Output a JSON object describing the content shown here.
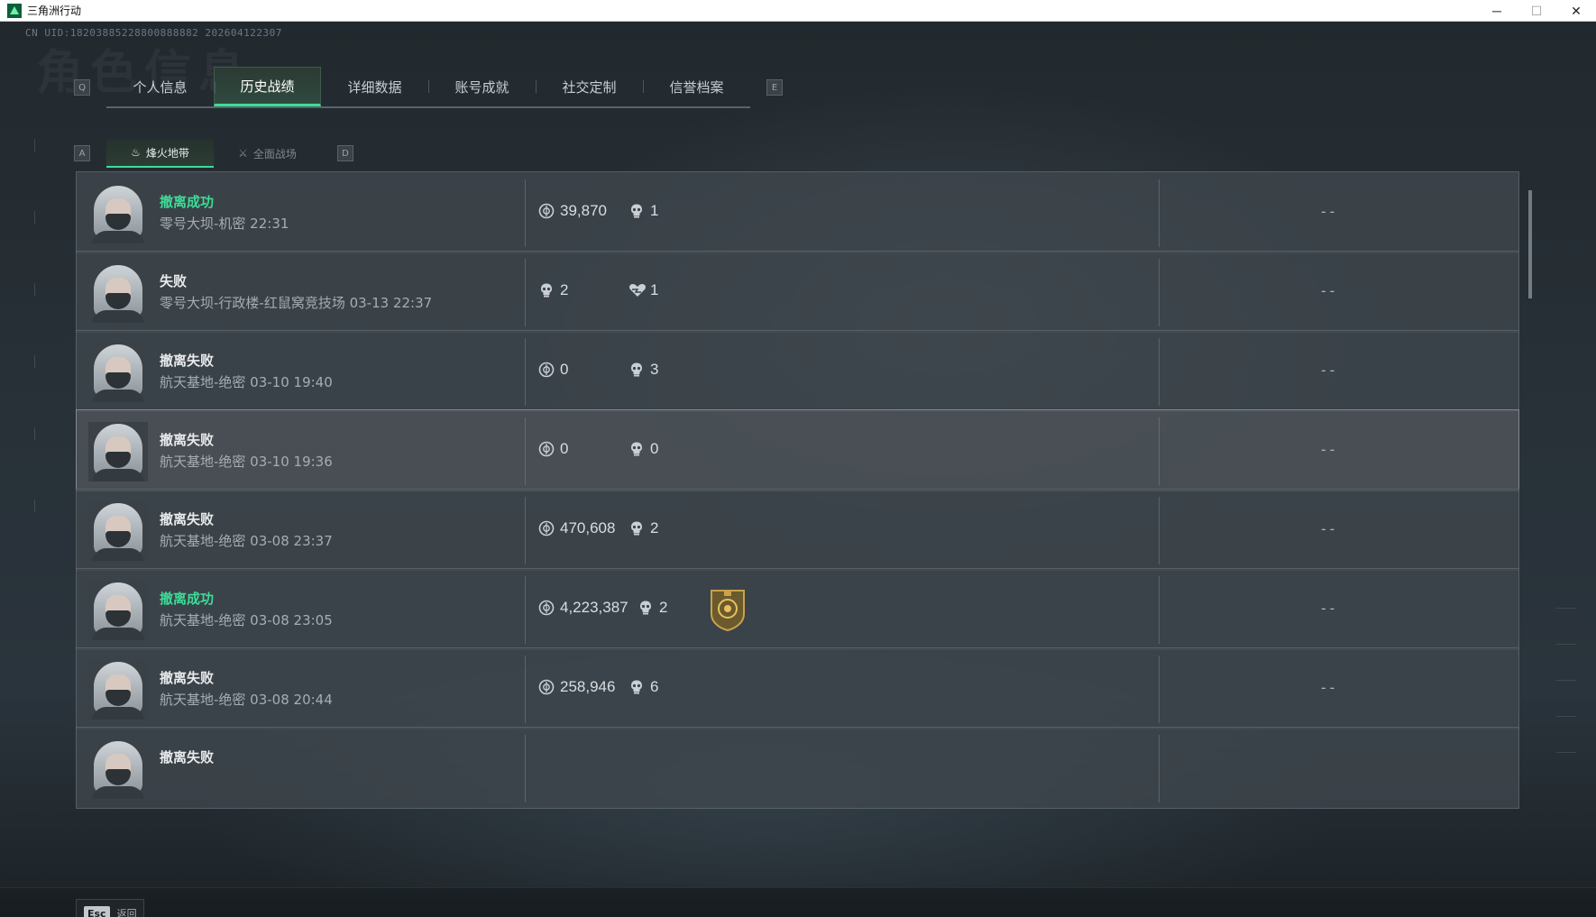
{
  "window": {
    "title": "三角洲行动",
    "minimize_glyph": "─",
    "maximize_glyph": "☐",
    "close_glyph": "✕"
  },
  "uid_text": "CN UID:18203885228800888882 202604122307",
  "background_title": "角色信息",
  "tabs": {
    "prev_key": "Q",
    "next_key": "E",
    "items": [
      {
        "label": "个人信息",
        "active": false
      },
      {
        "label": "历史战绩",
        "active": true
      },
      {
        "label": "详细数据",
        "active": false
      },
      {
        "label": "账号成就",
        "active": false
      },
      {
        "label": "社交定制",
        "active": false
      },
      {
        "label": "信誉档案",
        "active": false
      }
    ]
  },
  "subtabs": {
    "prev_key": "A",
    "next_key": "D",
    "items": [
      {
        "label": "烽火地带",
        "icon": "fire-zone-icon",
        "active": true
      },
      {
        "label": "全面战场",
        "icon": "battlefield-icon",
        "active": false
      }
    ]
  },
  "records": [
    {
      "status": "撤离成功",
      "success": true,
      "detail": "零号大坝-机密 22:31",
      "stats": [
        {
          "icon": "coin-icon",
          "value": "39,870"
        },
        {
          "icon": "kill-icon",
          "value": "1"
        }
      ],
      "medal": false,
      "right": "--"
    },
    {
      "status": "失败",
      "success": false,
      "detail": "零号大坝-行政楼-红鼠窝竞技场 03-13 22:37",
      "stats": [
        {
          "icon": "kill-icon",
          "value": "2"
        },
        {
          "icon": "assist-icon",
          "value": "1"
        }
      ],
      "medal": false,
      "right": "--"
    },
    {
      "status": "撤离失败",
      "success": false,
      "detail": "航天基地-绝密 03-10 19:40",
      "stats": [
        {
          "icon": "coin-icon",
          "value": "0"
        },
        {
          "icon": "kill-icon",
          "value": "3"
        }
      ],
      "medal": false,
      "right": "--"
    },
    {
      "status": "撤离失败",
      "success": false,
      "detail": "航天基地-绝密 03-10 19:36",
      "stats": [
        {
          "icon": "coin-icon",
          "value": "0"
        },
        {
          "icon": "kill-icon",
          "value": "0"
        }
      ],
      "medal": false,
      "right": "--"
    },
    {
      "status": "撤离失败",
      "success": false,
      "detail": "航天基地-绝密 03-08 23:37",
      "stats": [
        {
          "icon": "coin-icon",
          "value": "470,608"
        },
        {
          "icon": "kill-icon",
          "value": "2"
        }
      ],
      "medal": false,
      "right": "--"
    },
    {
      "status": "撤离成功",
      "success": true,
      "detail": "航天基地-绝密 03-08 23:05",
      "stats": [
        {
          "icon": "coin-icon",
          "value": "4,223,387"
        },
        {
          "icon": "kill-icon",
          "value": "2"
        }
      ],
      "medal": true,
      "right": "--"
    },
    {
      "status": "撤离失败",
      "success": false,
      "detail": "航天基地-绝密 03-08 20:44",
      "stats": [
        {
          "icon": "coin-icon",
          "value": "258,946"
        },
        {
          "icon": "kill-icon",
          "value": "6"
        }
      ],
      "medal": false,
      "right": "--"
    },
    {
      "status": "撤离失败",
      "success": false,
      "detail": "",
      "stats": [],
      "medal": false,
      "right": ""
    }
  ],
  "bottom": {
    "esc_key": "Esc",
    "esc_label": "返回"
  },
  "colors": {
    "accent": "#3ddc97",
    "panel": "#40484e",
    "medal": "#b08a3a"
  }
}
